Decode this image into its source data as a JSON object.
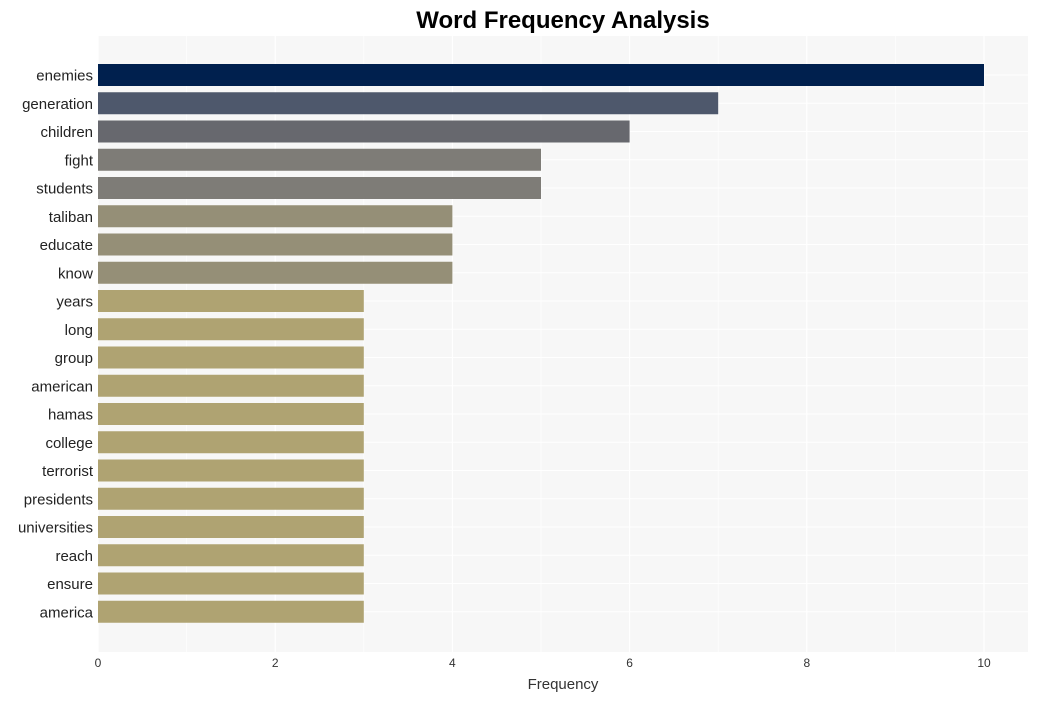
{
  "chart_data": {
    "type": "bar",
    "orientation": "horizontal",
    "title": "Word Frequency Analysis",
    "xlabel": "Frequency",
    "ylabel": "",
    "xlim": [
      0,
      10.5
    ],
    "xticks": [
      0,
      2,
      4,
      6,
      8,
      10
    ],
    "grid": true,
    "legend": "none",
    "categories": [
      "enemies",
      "generation",
      "children",
      "fight",
      "students",
      "taliban",
      "educate",
      "know",
      "years",
      "long",
      "group",
      "american",
      "hamas",
      "college",
      "terrorist",
      "presidents",
      "universities",
      "reach",
      "ensure",
      "america"
    ],
    "values": [
      10,
      7,
      6,
      5,
      5,
      4,
      4,
      4,
      3,
      3,
      3,
      3,
      3,
      3,
      3,
      3,
      3,
      3,
      3,
      3
    ],
    "colors": {
      "10": "#00204e",
      "7": "#4e586c",
      "6": "#67686e",
      "5": "#7e7c77",
      "4": "#958f77",
      "3": "#afa372"
    },
    "background": "#f7f7f7",
    "gridline_color": "#ffffff"
  }
}
